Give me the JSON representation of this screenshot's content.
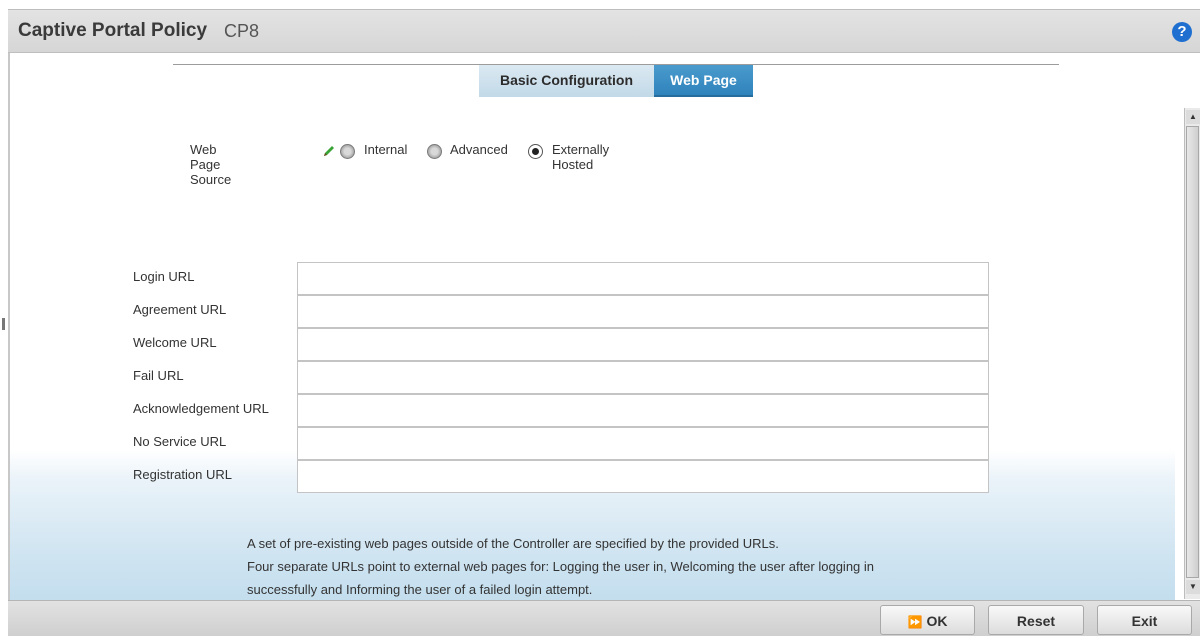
{
  "header": {
    "title": "Captive Portal Policy",
    "policy_name": "CP8",
    "help_icon": "?"
  },
  "tabs": [
    {
      "label": "Basic Configuration",
      "active": false
    },
    {
      "label": "Web Page",
      "active": true
    }
  ],
  "web_page_source": {
    "label": "Web Page Source",
    "options": [
      {
        "label": "Internal",
        "selected": false
      },
      {
        "label": "Advanced",
        "selected": false
      },
      {
        "label": "Externally Hosted",
        "selected": true
      }
    ]
  },
  "url_fields": [
    {
      "label": "Login URL",
      "value": ""
    },
    {
      "label": "Agreement URL",
      "value": ""
    },
    {
      "label": "Welcome URL",
      "value": ""
    },
    {
      "label": "Fail URL",
      "value": ""
    },
    {
      "label": "Acknowledgement URL",
      "value": ""
    },
    {
      "label": "No Service URL",
      "value": ""
    },
    {
      "label": "Registration URL",
      "value": ""
    }
  ],
  "help_text": {
    "line1": "A set of pre-existing web pages outside of the Controller are specified by the provided URLs.",
    "line2": "Four separate URLs point to external web pages for: Logging the user in, Welcoming the user after logging in",
    "line3": "successfully and Informing the user of a failed login attempt."
  },
  "buttons": {
    "ok": "OK",
    "reset": "Reset",
    "exit": "Exit"
  },
  "colors": {
    "accent": "#2f83bc",
    "help_icon": "#1f6fd1"
  }
}
